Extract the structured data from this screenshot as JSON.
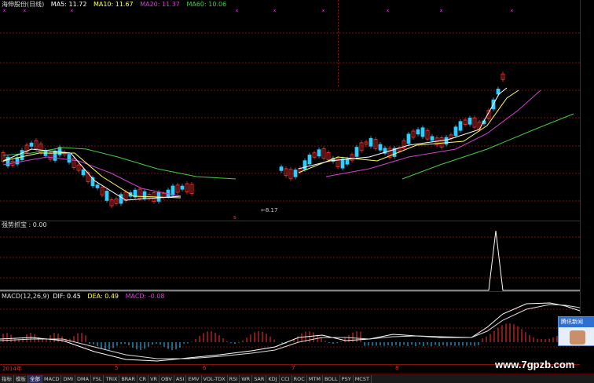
{
  "main_pane": {
    "title": "海伸股份(日线)",
    "ma5": "MA5: 11.72",
    "ma10": "MA10: 11.67",
    "ma20": "MA20: 11.37",
    "ma60": "MA60: 10.06",
    "low_marker": "8.17",
    "colors": {
      "ma5": "#ffffff",
      "ma10": "#ffff66",
      "ma20": "#cc44cc",
      "ma60": "#44cc44",
      "up": "#ff3333",
      "down": "#33ccff"
    }
  },
  "indicator_pane": {
    "title": "强势抓宝 : 0.00"
  },
  "macd_pane": {
    "title": "MACD(12,26,9)",
    "dif": "DIF: 0.45",
    "dea": "DEA: 0.49",
    "macd": "MACD: -0.08"
  },
  "timeline": {
    "year": "2014年",
    "months": [
      "5",
      "6",
      "7",
      "8"
    ]
  },
  "bottom_tabs": [
    "指标",
    "模板",
    "全部",
    "MACD",
    "DMI",
    "DMA",
    "FSL",
    "TRIX",
    "BRAR",
    "CR",
    "VR",
    "OBV",
    "ASI",
    "EMV",
    "VOL-TDX",
    "RSI",
    "WR",
    "SAR",
    "KDJ",
    "CCI",
    "ROC",
    "MTM",
    "BOLL",
    "PSY",
    "MCST"
  ],
  "watermark": "www.7gpzb.com",
  "popup": {
    "label": "腾讯新闻"
  }
}
